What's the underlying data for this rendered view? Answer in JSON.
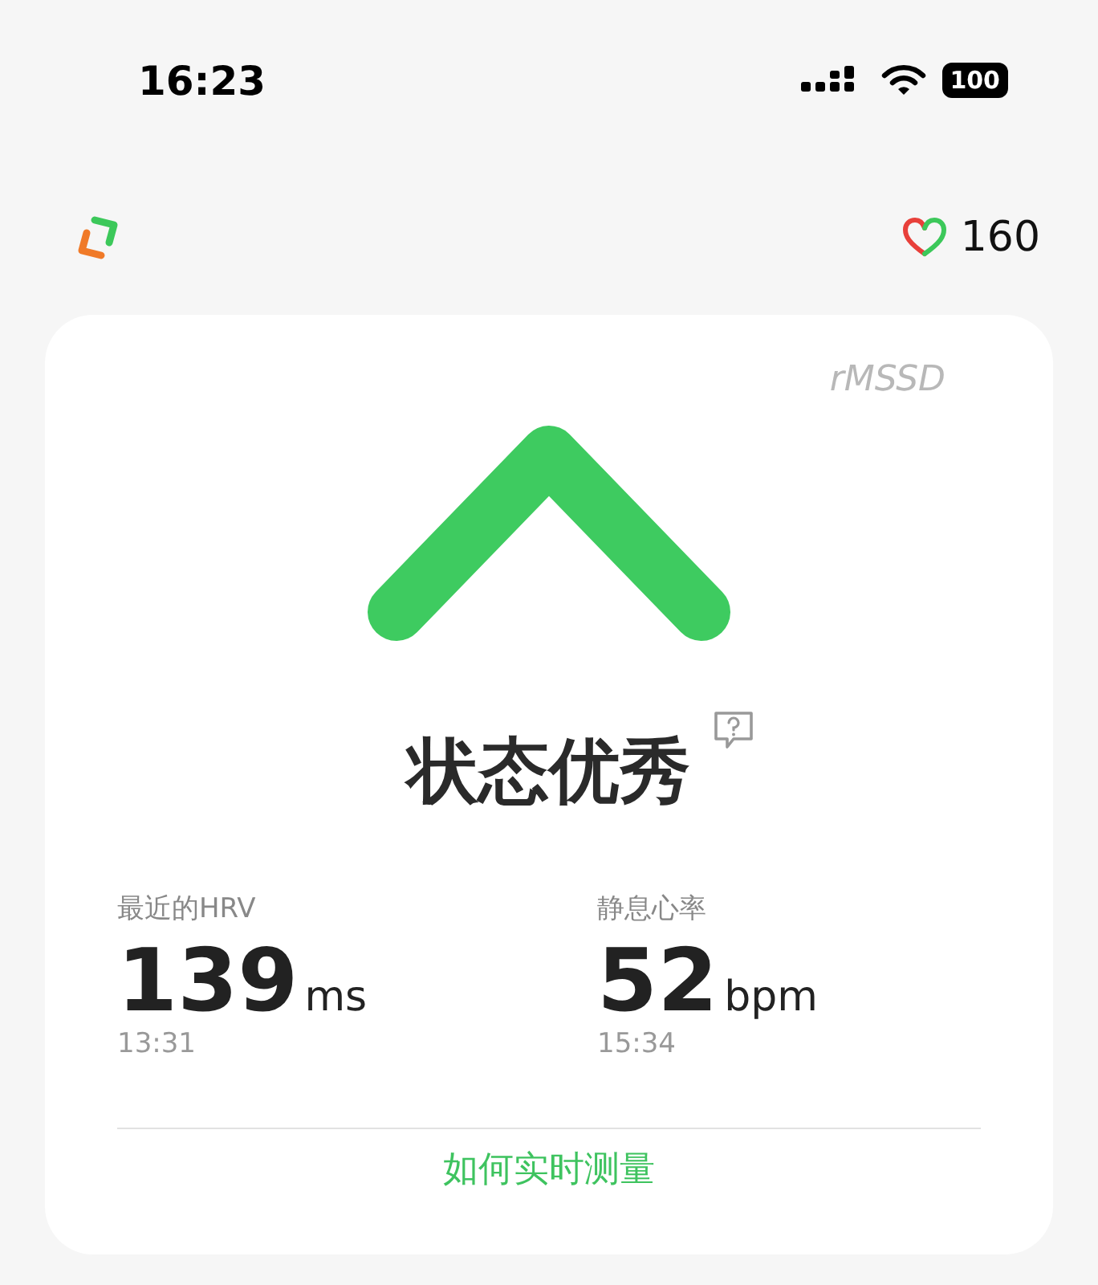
{
  "status_bar": {
    "time": "16:23",
    "battery": "100"
  },
  "header": {
    "score": "160"
  },
  "card": {
    "metric": "rMSSD",
    "status": "状态优秀",
    "stats": [
      {
        "label": "最近的HRV",
        "value": "139",
        "unit": "ms",
        "time": "13:31"
      },
      {
        "label": "静息心率",
        "value": "52",
        "unit": "bpm",
        "time": "15:34"
      }
    ],
    "link": "如何实时测量"
  }
}
